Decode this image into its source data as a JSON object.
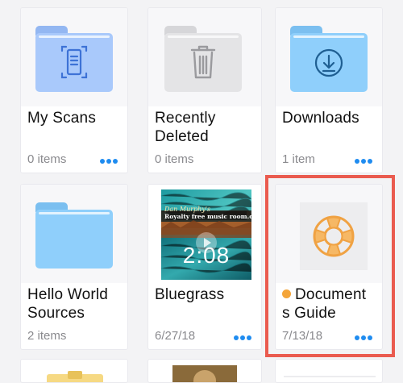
{
  "files": [
    {
      "title": "My Scans",
      "meta": "0 items",
      "icon": "scan-document-icon"
    },
    {
      "title": "Recently Deleted",
      "meta": "0 items",
      "icon": "trash-icon"
    },
    {
      "title": "Downloads",
      "meta": "1 item",
      "icon": "download-icon"
    },
    {
      "title": "Hello World Sources",
      "meta": "2 items",
      "icon": "folder-icon"
    },
    {
      "title": "Bluegrass",
      "meta": "6/27/18",
      "icon": "video-thumbnail",
      "thumb_banner": "Royalty free music room.com",
      "thumb_brand": "Dan Murphy's",
      "duration": "2:08"
    },
    {
      "title": "Documents Guide",
      "title_line1": "Document",
      "title_line2": "s Guide",
      "meta": "7/13/18",
      "icon": "lifebuoy-icon",
      "tag_color": "#f4a53a"
    }
  ],
  "colors": {
    "folder_blue": "#a9c9fb",
    "folder_gray": "#e4e4e6",
    "folder_lightblue": "#8fcffb",
    "accent": "#1f8cf0",
    "highlight": "#ea5b4f"
  }
}
